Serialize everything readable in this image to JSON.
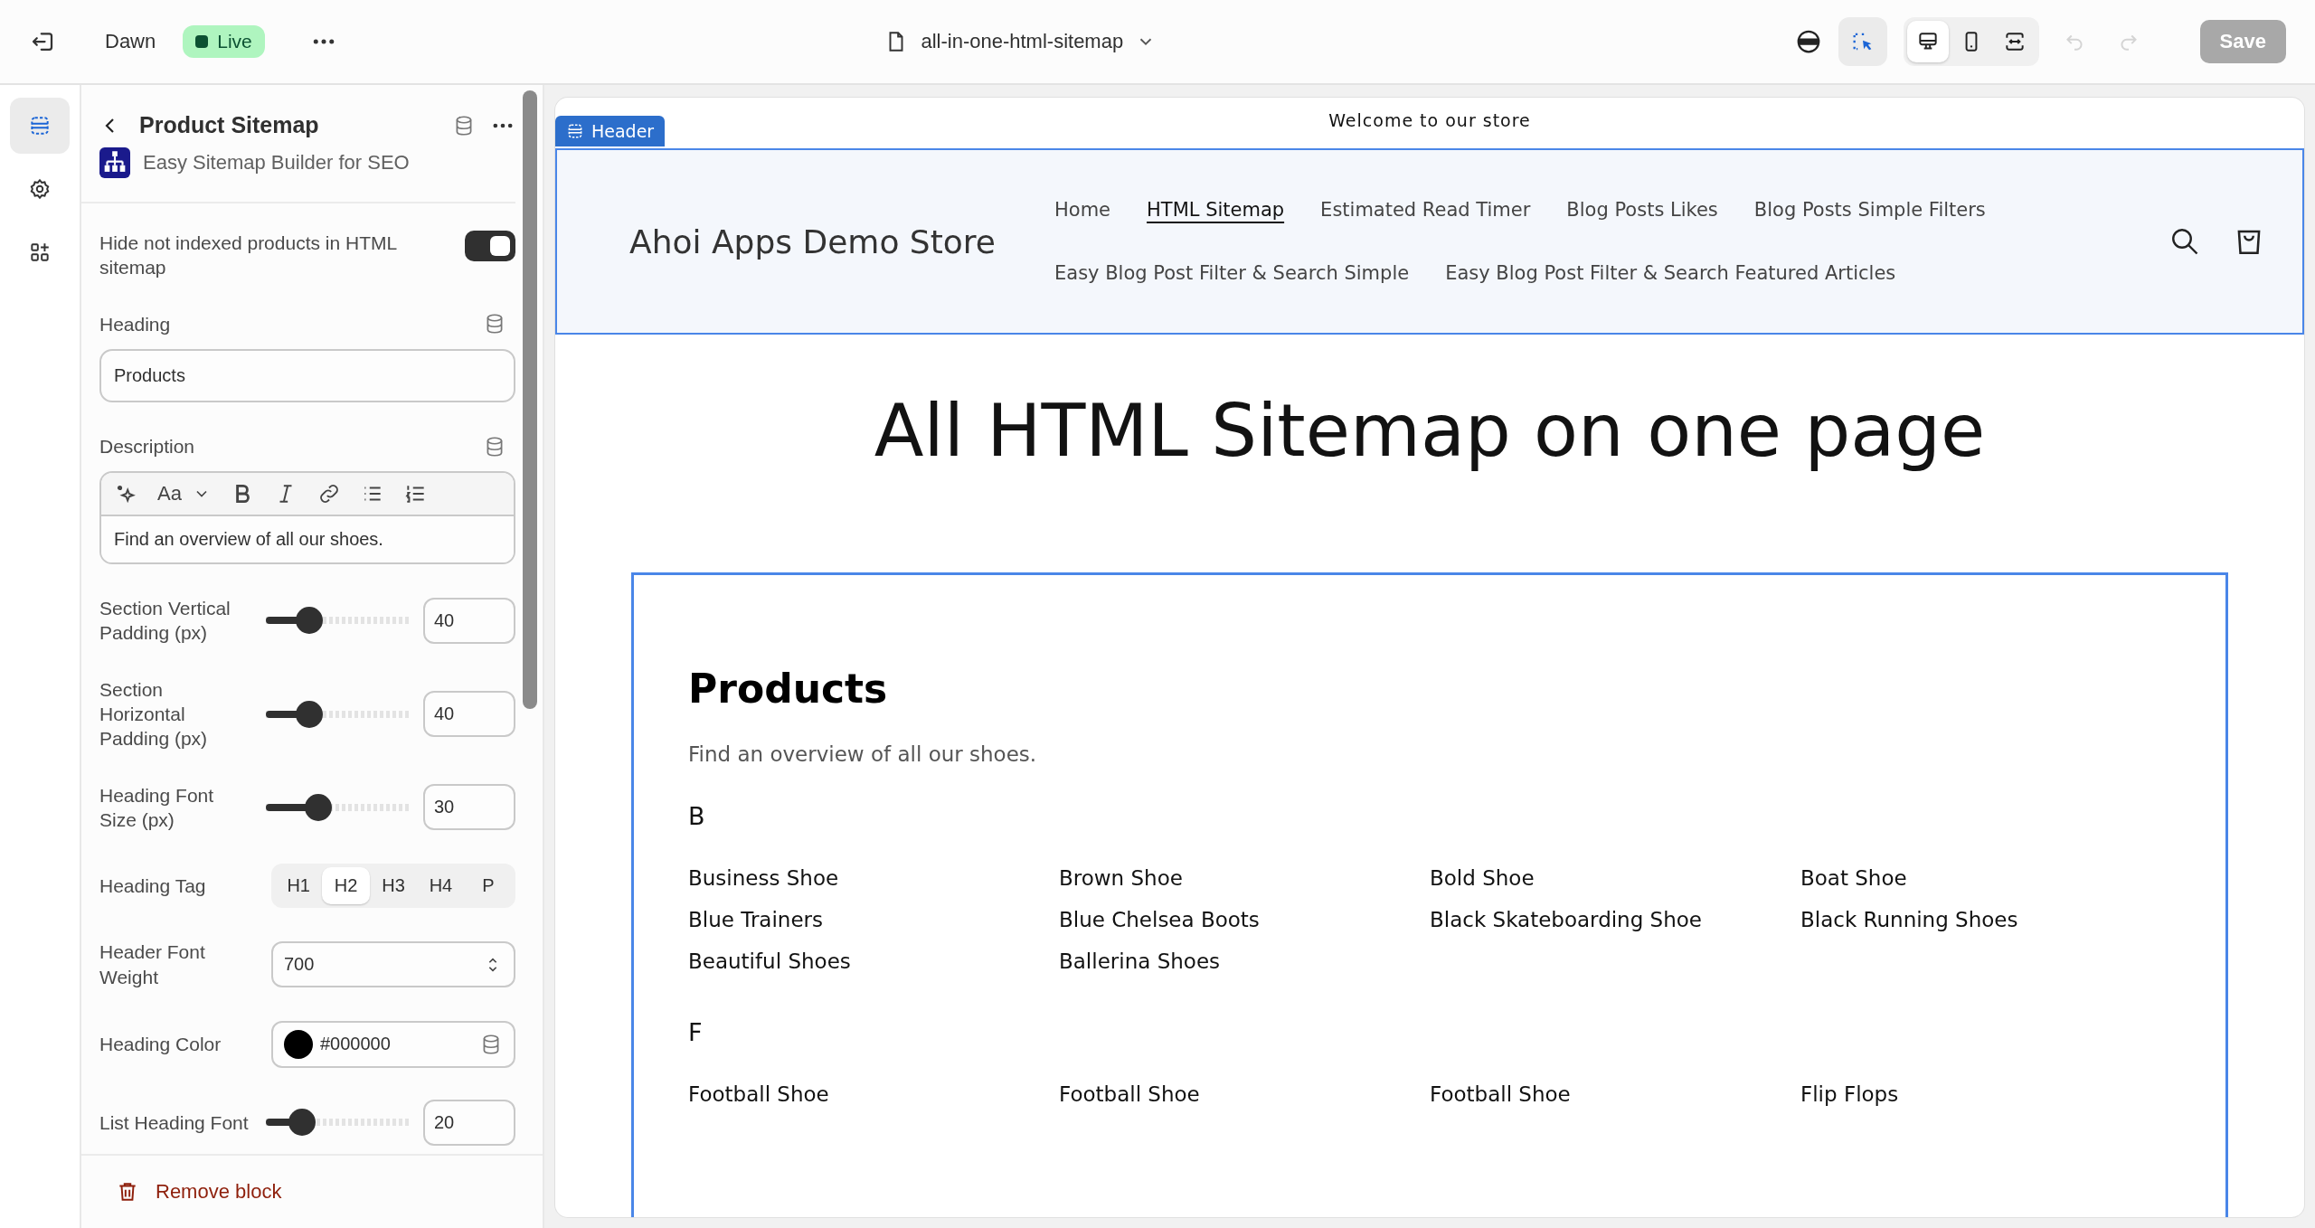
{
  "topbar": {
    "theme": "Dawn",
    "status": "Live",
    "template": "all-in-one-html-sitemap",
    "inspector_selected": true,
    "devices": [
      {
        "kind": "desktop",
        "selected": true
      },
      {
        "kind": "mobile",
        "selected": false
      },
      {
        "kind": "fullwidth",
        "selected": false
      }
    ],
    "undo_disabled": true,
    "redo_disabled": true,
    "save": {
      "label": "Save",
      "disabled": true
    }
  },
  "rail": [
    {
      "kind": "sections",
      "selected": true
    },
    {
      "kind": "settings",
      "selected": false
    },
    {
      "kind": "apps",
      "selected": false
    }
  ],
  "panel": {
    "title": "Product Sitemap",
    "app_name": "Easy Sitemap Builder for SEO",
    "settings": [
      {
        "kind": "toggle",
        "label": "Hide not indexed products in HTML sitemap",
        "on": true
      },
      {
        "kind": "text",
        "label": "Heading",
        "value": "Products"
      },
      {
        "kind": "richtext",
        "label": "Description",
        "font_label": "Aa",
        "value": "Find an overview of all our shoes."
      },
      {
        "kind": "slider",
        "label": "Section Vertical Padding (px)",
        "level": 0.25,
        "value": "40"
      },
      {
        "kind": "slider",
        "label": "Section Horizontal Padding (px)",
        "level": 0.25,
        "value": "40"
      },
      {
        "kind": "slider",
        "label": "Heading Font Size (px)",
        "level": 0.33,
        "value": "30"
      },
      {
        "kind": "segmented",
        "label": "Heading Tag",
        "options": [
          {
            "label": "H1",
            "selected": false
          },
          {
            "label": "H2",
            "selected": true
          },
          {
            "label": "H3",
            "selected": false
          },
          {
            "label": "H4",
            "selected": false
          },
          {
            "label": "P",
            "selected": false
          }
        ]
      },
      {
        "kind": "select",
        "label": "Header Font Weight",
        "value": "700"
      },
      {
        "kind": "color",
        "label": "Heading Color",
        "color": "#000000",
        "value": "#000000"
      },
      {
        "kind": "slider",
        "label": "List Heading Font",
        "level": 0.19,
        "value": "20"
      }
    ],
    "remove": "Remove block"
  },
  "preview": {
    "announcement": "Welcome to our store",
    "header_tag": "Header",
    "store_name": "Ahoi Apps Demo Store",
    "nav": [
      {
        "label": "Home",
        "selected": false
      },
      {
        "label": "HTML Sitemap",
        "selected": true
      },
      {
        "label": "Estimated Read Timer",
        "selected": false
      },
      {
        "label": "Blog Posts Likes",
        "selected": false
      },
      {
        "label": "Blog Posts Simple Filters",
        "selected": false
      },
      {
        "label": "Easy Blog Post Filter & Search Simple",
        "selected": false
      },
      {
        "label": "Easy Blog Post Filter & Search Featured Articles",
        "selected": false
      }
    ],
    "page_title": "All HTML Sitemap on one page",
    "section": {
      "heading": "Products",
      "description": "Find an overview of all our shoes.",
      "groups": [
        {
          "letter": "B",
          "items": [
            "Business Shoe",
            "Brown Shoe",
            "Bold Shoe",
            "Boat Shoe",
            "Blue Trainers",
            "Blue Chelsea Boots",
            "Black Skateboarding Shoe",
            "Black Running Shoes",
            "Beautiful Shoes",
            "Ballerina Shoes"
          ]
        },
        {
          "letter": "F",
          "items": [
            "Football Shoe",
            "Football Shoe",
            "Football Shoe",
            "Flip Flops"
          ]
        }
      ]
    }
  }
}
